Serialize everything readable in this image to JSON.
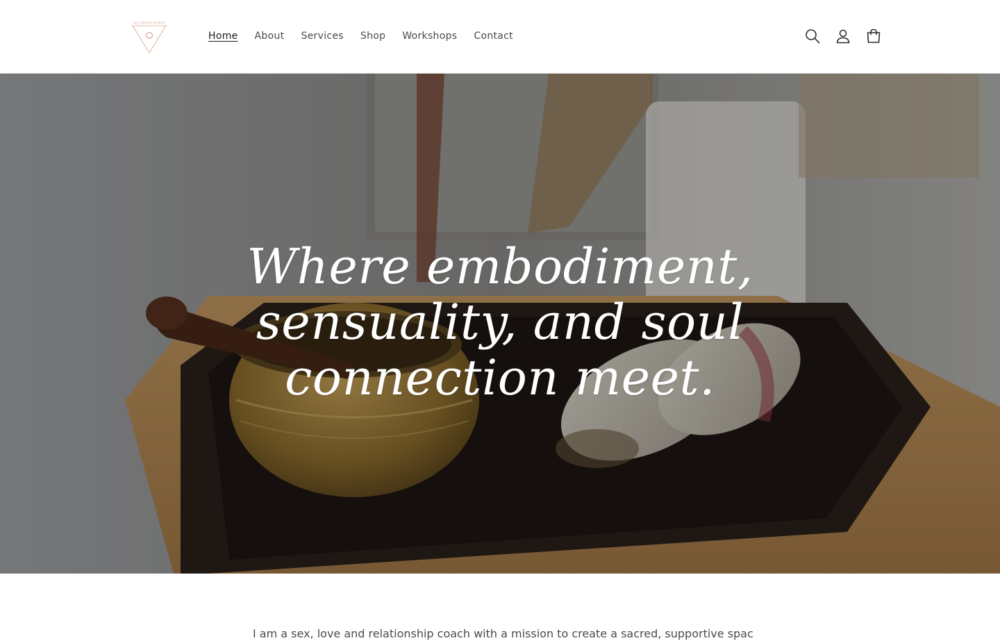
{
  "header": {
    "logo_text": "ALL THINGS SACRED",
    "nav": [
      {
        "label": "Home",
        "active": true
      },
      {
        "label": "About",
        "active": false
      },
      {
        "label": "Services",
        "active": false
      },
      {
        "label": "Shop",
        "active": false
      },
      {
        "label": "Workshops",
        "active": false
      },
      {
        "label": "Contact",
        "active": false
      }
    ],
    "icons": [
      "search-icon",
      "account-icon",
      "cart-icon"
    ]
  },
  "hero": {
    "heading": "Where embodiment, sensuality, and soul connection meet."
  },
  "intro": {
    "text": "I am a sex, love and relationship coach with a mission to create a sacred, supportive space to guide"
  },
  "colors": {
    "text_dark": "#1a1a1a",
    "text_muted": "#4a4a4a",
    "logo_accent": "#d9a08a"
  }
}
